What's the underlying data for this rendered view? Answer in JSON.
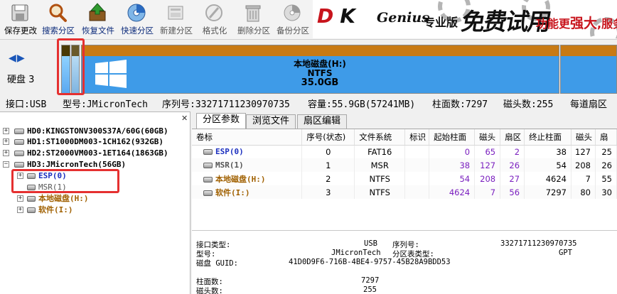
{
  "toolbar": {
    "items": [
      {
        "label": "保存更改",
        "icon": "save-icon"
      },
      {
        "label": "搜索分区",
        "icon": "search-icon"
      },
      {
        "label": "恢复文件",
        "icon": "recover-file-icon"
      },
      {
        "label": "快速分区",
        "icon": "quick-partition-icon"
      },
      {
        "label": "新建分区",
        "icon": "new-partition-icon"
      },
      {
        "label": "格式化",
        "icon": "format-icon"
      },
      {
        "label": "删除分区",
        "icon": "delete-icon"
      },
      {
        "label": "备份分区",
        "icon": "backup-icon"
      }
    ]
  },
  "banner": {
    "brand_d": "D",
    "brand_k": "K",
    "brand_sub": "Genius",
    "edition": "专业版",
    "free": "免费试用",
    "slogan_pre": "功能更",
    "slogan_big": "强大",
    "slogan_post": ",服务"
  },
  "disk": {
    "label": "硬盘 3",
    "partition_name": "本地磁盘(H:)",
    "partition_fs": "NTFS",
    "partition_size": "35.0GB"
  },
  "info": {
    "interface": "接口:USB",
    "model": "型号:JMicronTech",
    "serial": "序列号:33271711230970735",
    "capacity": "容量:55.9GB(57241MB)",
    "cylinders": "柱面数:7297",
    "heads": "磁头数:255",
    "sectors": "每道扇区"
  },
  "tree": {
    "disks": [
      "HD0:KINGSTONV300S37A/60G(60GB)",
      "HD1:ST1000DM003-1CH162(932GB)",
      "HD2:ST2000VM003-1ET164(1863GB)",
      "HD3:JMicronTech(56GB)"
    ],
    "partitions": [
      "ESP(0)",
      "MSR(1)",
      "本地磁盘(H:)",
      "软件(I:)"
    ]
  },
  "tabs": [
    "分区参数",
    "浏览文件",
    "扇区编辑"
  ],
  "table": {
    "headers": [
      "卷标",
      "序号(状态)",
      "文件系统",
      "标识",
      "起始柱面",
      "磁头",
      "扇区",
      "终止柱面",
      "磁头",
      "扇"
    ],
    "rows": [
      {
        "name": "ESP(0)",
        "index": "0",
        "fs": "FAT16",
        "id": "",
        "start_cyl": "0",
        "start_head": "65",
        "start_sec": "2",
        "end_cyl": "38",
        "end_head": "127",
        "end_sec": "25"
      },
      {
        "name": "MSR(1)",
        "index": "1",
        "fs": "MSR",
        "id": "",
        "start_cyl": "38",
        "start_head": "127",
        "start_sec": "26",
        "end_cyl": "54",
        "end_head": "208",
        "end_sec": "26"
      },
      {
        "name": "本地磁盘(H:)",
        "index": "2",
        "fs": "NTFS",
        "id": "",
        "start_cyl": "54",
        "start_head": "208",
        "start_sec": "27",
        "end_cyl": "4624",
        "end_head": "7",
        "end_sec": "55"
      },
      {
        "name": "软件(I:)",
        "index": "3",
        "fs": "NTFS",
        "id": "",
        "start_cyl": "4624",
        "start_head": "7",
        "start_sec": "56",
        "end_cyl": "7297",
        "end_head": "80",
        "end_sec": "30"
      }
    ]
  },
  "details": {
    "interface_label": "接口类型:",
    "interface_value": "USB",
    "serial_label": "序列号:",
    "serial_value": "33271711230970735",
    "model_label": "型号:",
    "model_value": "JMicronTech",
    "ptable_label": "分区表类型:",
    "ptable_value": "GPT",
    "guid_label": "磁盘 GUID:",
    "guid_value": "41D0D9F6-716B-4BE4-9757-45B28A9BDD53",
    "cyl_label": "柱面数:",
    "cyl_value": "7297",
    "heads_label": "磁头数:",
    "heads_value": "255"
  }
}
